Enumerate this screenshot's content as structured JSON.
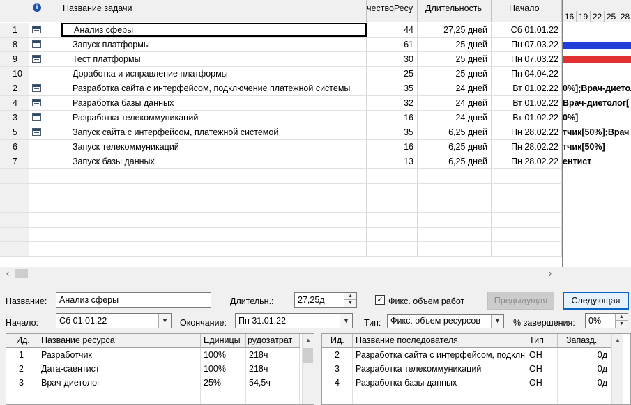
{
  "grid": {
    "headers": {
      "info": "i",
      "name": "Название задачи",
      "units": "чествоРесу",
      "duration": "Длительность",
      "start": "Начало"
    },
    "rows": [
      {
        "id": "1",
        "has_icon": true,
        "name": "Анализ сферы",
        "units": "44",
        "duration": "27,25 дней",
        "start": "Сб 01.01.22"
      },
      {
        "id": "8",
        "has_icon": true,
        "name": "Запуск платформы",
        "units": "61",
        "duration": "25 дней",
        "start": "Пн 07.03.22"
      },
      {
        "id": "9",
        "has_icon": true,
        "name": "Тест платформы",
        "units": "30",
        "duration": "25 дней",
        "start": "Пн 07.03.22"
      },
      {
        "id": "10",
        "has_icon": false,
        "name": "Доработка и исправление платформы",
        "units": "25",
        "duration": "25 дней",
        "start": "Пн 04.04.22"
      },
      {
        "id": "2",
        "has_icon": true,
        "name": "Разработка сайта с интерфейсом, подключение платежной системы",
        "units": "35",
        "duration": "24 дней",
        "start": "Вт 01.02.22"
      },
      {
        "id": "4",
        "has_icon": true,
        "name": "Разработка базы данных",
        "units": "32",
        "duration": "24 дней",
        "start": "Вт 01.02.22"
      },
      {
        "id": "3",
        "has_icon": true,
        "name": "Разработка телекоммуникаций",
        "units": "16",
        "duration": "24 дней",
        "start": "Вт 01.02.22"
      },
      {
        "id": "5",
        "has_icon": true,
        "name": "Запуск сайта с интерфейсом, платежной системой",
        "units": "35",
        "duration": "6,25 дней",
        "start": "Пн 28.02.22"
      },
      {
        "id": "6",
        "has_icon": false,
        "name": "Запуск телекоммуникаций",
        "units": "16",
        "duration": "6,25 дней",
        "start": "Пн 28.02.22"
      },
      {
        "id": "7",
        "has_icon": false,
        "name": "Запуск базы данных",
        "units": "13",
        "duration": "6,25 дней",
        "start": "Пн 28.02.22"
      }
    ]
  },
  "gantt": {
    "days": [
      "16",
      "19",
      "22",
      "25",
      "28"
    ],
    "labels": [
      "0%];Врач-диетол",
      "Врач-диетолог[",
      "0%]",
      "тчик[50%];Врач",
      "тчик[50%]",
      "ентист"
    ],
    "bar_colors": {
      "blue": "#1f3fd8",
      "red": "#e03030"
    }
  },
  "form": {
    "name_label": "Название:",
    "name_value": "Анализ сферы",
    "duration_label": "Длительн.:",
    "duration_value": "27,25д",
    "fixed_work_label": "Фикс. объем работ",
    "fixed_work_checked": true,
    "prev_button": "Предыдущая",
    "next_button": "Следующая",
    "start_label": "Начало:",
    "start_value": "Сб 01.01.22",
    "end_label": "Окончание:",
    "end_value": "Пн 31.01.22",
    "type_label": "Тип:",
    "type_value": "Фикс. объем ресурсов",
    "percent_label": "% завершения:",
    "percent_value": "0%"
  },
  "resources": {
    "headers": {
      "id": "Ид.",
      "name": "Название ресурса",
      "units": "Единицы",
      "work": "рудозатрат"
    },
    "rows": [
      {
        "id": "1",
        "name": "Разработчик",
        "units": "100%",
        "work": "218ч"
      },
      {
        "id": "2",
        "name": "Дата-саентист",
        "units": "100%",
        "work": "218ч"
      },
      {
        "id": "3",
        "name": "Врач-диетолог",
        "units": "25%",
        "work": "54,5ч"
      }
    ]
  },
  "successors": {
    "headers": {
      "id": "Ид.",
      "name": "Название последователя",
      "type": "Тип",
      "lag": "Запазд."
    },
    "rows": [
      {
        "id": "2",
        "name": "Разработка сайта с интерфейсом, подклн",
        "type": "ОН",
        "lag": "0д"
      },
      {
        "id": "3",
        "name": "Разработка телекоммуникаций",
        "type": "ОН",
        "lag": "0д"
      },
      {
        "id": "4",
        "name": "Разработка базы данных",
        "type": "ОН",
        "lag": "0д"
      }
    ]
  }
}
